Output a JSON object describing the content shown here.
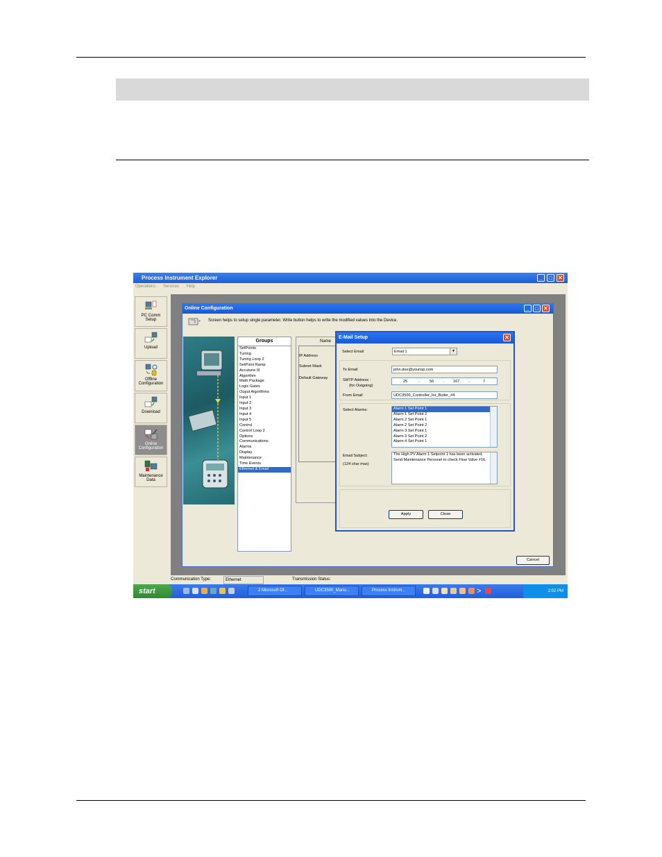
{
  "app": {
    "title": "Process Instrument Explorer",
    "menu": [
      "Operations",
      "Services",
      "Help"
    ]
  },
  "toolbar": [
    {
      "label": "PC Comm Setup",
      "lines": [
        "PC Comm",
        "Setup"
      ]
    },
    {
      "label": "Upload",
      "lines": [
        "Upload"
      ]
    },
    {
      "label": "Offline Configuration",
      "lines": [
        "Offline",
        "Configuration"
      ]
    },
    {
      "label": "Download",
      "lines": [
        "Download"
      ]
    },
    {
      "label": "Online Configuration",
      "lines": [
        "Online",
        "Configuration"
      ]
    },
    {
      "label": "Maintenance Data",
      "lines": [
        "Maintenance",
        "Data"
      ]
    }
  ],
  "online_config": {
    "title": "Online Configuration",
    "help": "Screen helps to setup single parameter. Write button helps to write the modified values into the Device.",
    "groups_header": "Groups",
    "groups": [
      "SetPoints",
      "Tuning",
      "Tuning Loop 2",
      "SetPoint Ramp",
      "Accutune III",
      "Algorithm",
      "Math Package",
      "Logic Gates",
      "Ouput Algorithms",
      "Input 1",
      "Input 2",
      "Input 3",
      "Input 4",
      "Input 5",
      "Control",
      "Control Loop 2",
      "Options",
      "Communications",
      "Alarms",
      "Display",
      "Maintenance",
      "Time Events",
      "Ethernet & Email"
    ],
    "selected_group": "Ethernet & Email",
    "name_header": "Name",
    "names": [
      "IP Address",
      "Subnet Mask",
      "Default Gateway"
    ],
    "cancel": "Cancel"
  },
  "email_setup": {
    "title": "E-Mail Setup",
    "select_email_label": "Select Email",
    "select_email_value": "Email 1",
    "to_email_label": "To Email",
    "to_email_value": "john.doe@yourisp.com",
    "smtp_label": "SMTP Address :",
    "smtp_sub": "(for Outgoing)",
    "smtp_octets": [
      "25",
      "56",
      "167",
      "7"
    ],
    "from_email_label": "From Email",
    "from_email_value": "UDC3500_Controller_for_Boiler_#4",
    "select_alarms_label": "Select Alarms:",
    "alarms": [
      "Alarm 1 Set Point 1",
      "Alarm 1 Set Point 2",
      "Alarm 2 Set Point 1",
      "Alarm 2 Set Point 2",
      "Alarm 3 Set Point 1",
      "Alarm 3 Set Point 2",
      "Alarm 4 Set Point 1"
    ],
    "email_subject_label": "Email Subject:",
    "email_subject_limit": "(124 char max)",
    "email_subject_value": "The High PV Alarm 1 Setpoint 1 has been activated. Send Maintenance Personel to check Flow Valve #16.",
    "apply": "Apply",
    "close": "Close"
  },
  "status": {
    "comm_type_label": "Communication Type:",
    "comm_type_value": "Ethernet",
    "transmission_label": "Transmission Status:"
  },
  "taskbar": {
    "start": "start",
    "items": [
      "2 Microsoft Of...",
      "UDC3500_Manu...",
      "Process Instrum..."
    ],
    "clock": "2:02 PM"
  }
}
